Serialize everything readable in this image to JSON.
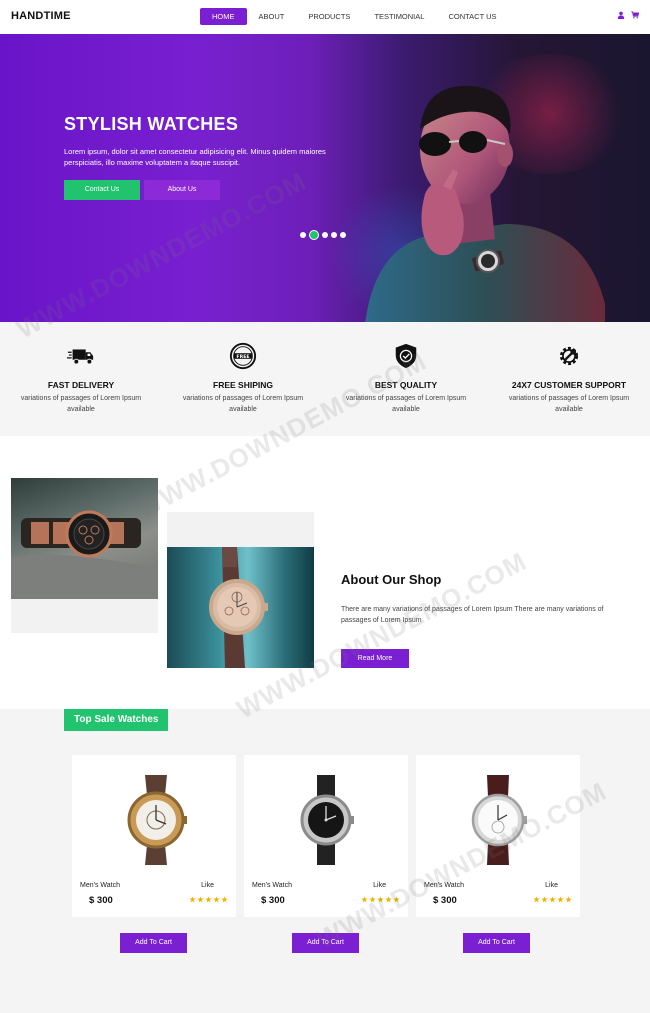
{
  "nav": {
    "logo": "HANDTIME",
    "items": [
      {
        "label": "HOME",
        "active": true
      },
      {
        "label": "ABOUT",
        "active": false
      },
      {
        "label": "PRODUCTS",
        "active": false
      },
      {
        "label": "TESTIMONIAL",
        "active": false
      },
      {
        "label": "CONTACT US",
        "active": false
      }
    ],
    "icons": [
      "user-icon",
      "cart-icon"
    ]
  },
  "hero": {
    "title": "STYLISH WATCHES",
    "text": "Lorem ipsum, dolor sit amet consectetur adipisicing elit. Minus quidem maiores perspiciatis, illo maxime voluptatem a itaque suscipit.",
    "contact_label": "Contact Us",
    "about_label": "About Us",
    "slides": 5,
    "active_slide": 2
  },
  "features": [
    {
      "icon": "truck-icon",
      "title": "FAST DELIVERY",
      "desc": "variations of passages of Lorem Ipsum available"
    },
    {
      "icon": "free-badge-icon",
      "title": "FREE SHIPING",
      "desc": "variations of passages of Lorem Ipsum available"
    },
    {
      "icon": "shield-check-icon",
      "title": "BEST QUALITY",
      "desc": "variations of passages of Lorem Ipsum available"
    },
    {
      "icon": "support-gear-icon",
      "title": "24X7 CUSTOMER SUPPORT",
      "desc": "variations of passages of Lorem Ipsum available"
    }
  ],
  "about": {
    "title": "About Our Shop",
    "text": "There are many variations of passages of Lorem Ipsum There are many variations of passages of Lorem Ipsum",
    "button": "Read More"
  },
  "products": {
    "section_title": "Top Sale Watches",
    "items": [
      {
        "name": "Men's Watch",
        "like": "Like",
        "price": "$ 300",
        "rating": 5,
        "button": "Add To Cart"
      },
      {
        "name": "Men's Watch",
        "like": "Like",
        "price": "$ 300",
        "rating": 5,
        "button": "Add To Cart"
      },
      {
        "name": "Men's Watch",
        "like": "Like",
        "price": "$ 300",
        "rating": 5,
        "button": "Add To Cart"
      }
    ]
  },
  "watermark": "WWW.DOWNDEMO.COM",
  "colors": {
    "accent": "#7b1fd3",
    "green": "#22c36f",
    "star": "#f0b400"
  }
}
